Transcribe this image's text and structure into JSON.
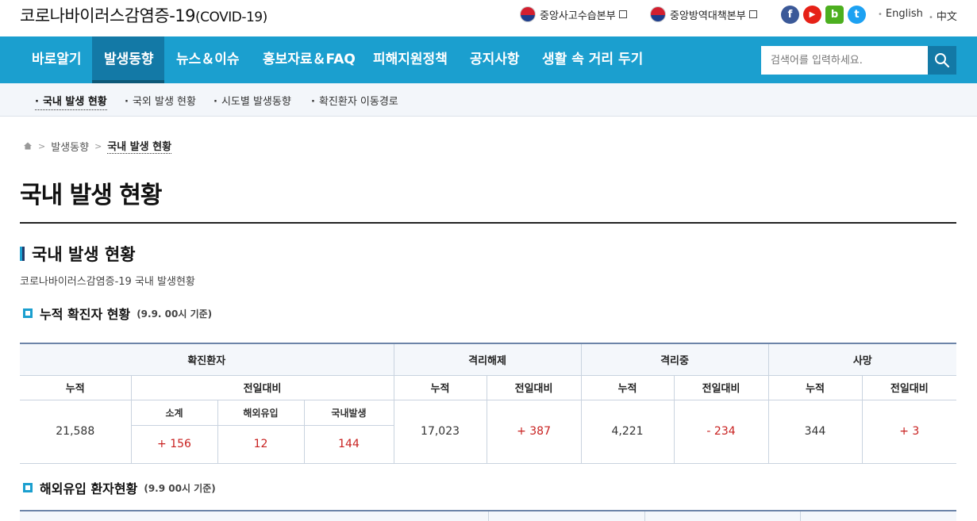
{
  "header": {
    "title": "코로나바이러스감염증-19",
    "title_sub": "(COVID-19)",
    "agencies": [
      "중앙사고수습본부",
      "중앙방역대책본부"
    ],
    "sns": [
      {
        "name": "facebook",
        "glyph": "f",
        "color": "#3b5998"
      },
      {
        "name": "youtube",
        "glyph": "▶",
        "color": "#e62117"
      },
      {
        "name": "blog",
        "glyph": "b",
        "color": "#4caf1f"
      },
      {
        "name": "twitter",
        "glyph": "t",
        "color": "#1da1f2"
      }
    ],
    "languages": [
      "English",
      "中文"
    ]
  },
  "gnb": {
    "items": [
      "바로알기",
      "발생동향",
      "뉴스＆이슈",
      "홍보자료＆FAQ",
      "피해지원정책",
      "공지사항",
      "생활 속 거리 두기"
    ],
    "active": "발생동향",
    "search_placeholder": "검색어를 입력하세요."
  },
  "lnb": {
    "items": [
      "국내 발생 현황",
      "국외 발생 현황",
      "시도별 발생동향",
      "확진환자 이동경로"
    ]
  },
  "breadcrumb": {
    "items": [
      "발생동향",
      "국내 발생 현황"
    ]
  },
  "page": {
    "title": "국내 발생 현황",
    "section_title": "국내 발생 현황",
    "section_desc": "코로나바이러스감염증-19 국내 발생현황",
    "sub_title": "누적 확진자 현황",
    "sub_note": "(9.9. 00시 기준)",
    "sub_title2": "해외유입 환자현황",
    "sub_note2": "(9.9 00시 기준)"
  },
  "table": {
    "groups": [
      "확진환자",
      "격리해제",
      "격리중",
      "사망"
    ],
    "cumulative": "누적",
    "daily": "전일대비",
    "subheads": [
      "소계",
      "해외유입",
      "국내발생"
    ],
    "confirmed_total": "21,588",
    "confirmed_daily": [
      "+ 156",
      "12",
      "144"
    ],
    "released_total": "17,023",
    "released_daily": "+ 387",
    "isolated_total": "4,221",
    "isolated_daily": "- 234",
    "deaths_total": "344",
    "deaths_daily": "+ 3"
  }
}
